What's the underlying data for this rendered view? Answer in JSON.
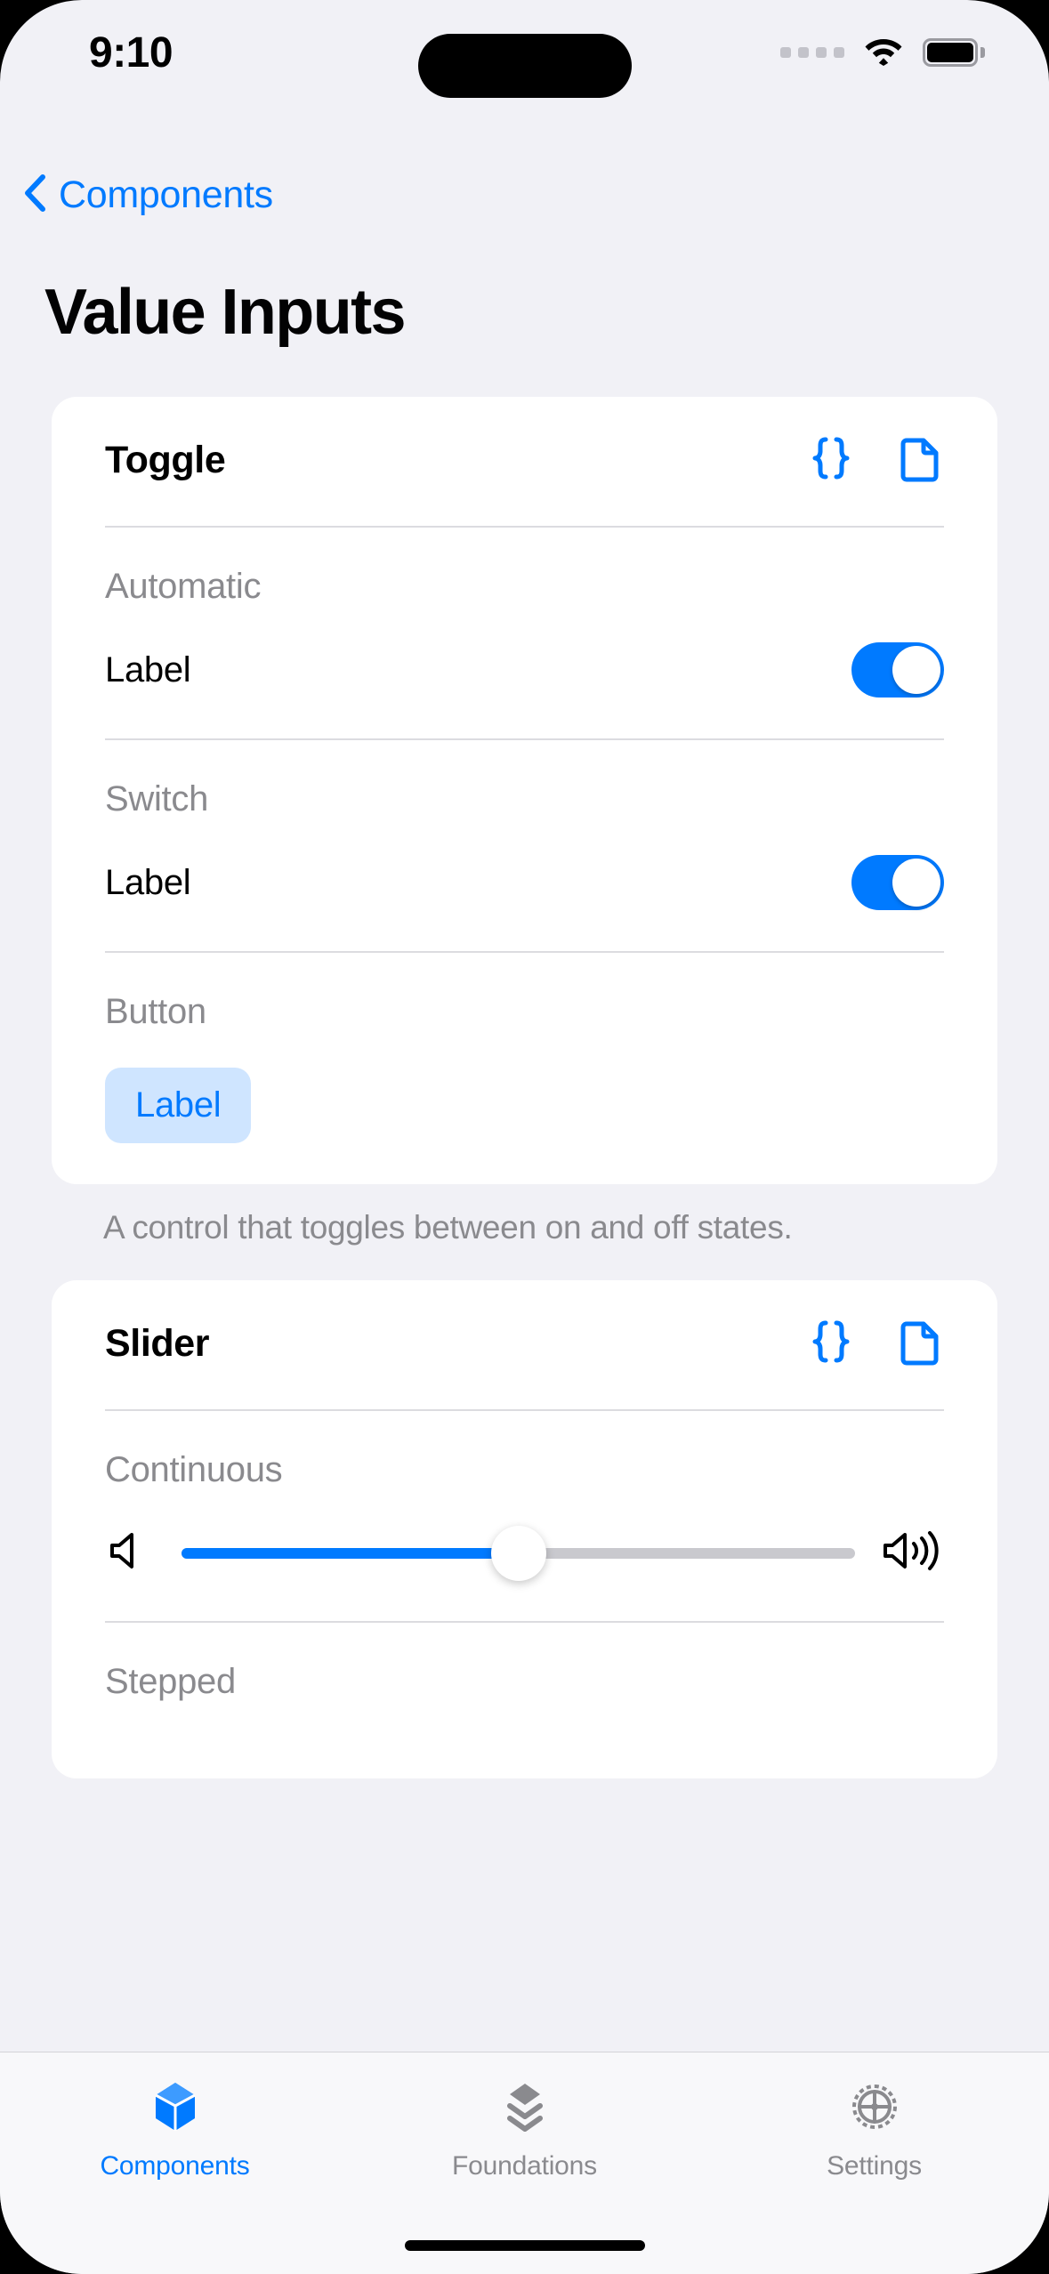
{
  "status_bar": {
    "time": "9:10",
    "signal_icon": "signal-dots-icon",
    "wifi_icon": "wifi-icon",
    "battery_icon": "battery-full-icon"
  },
  "nav": {
    "back_label": "Components",
    "back_icon": "chevron-left-icon",
    "accent": "#007aff"
  },
  "page_title": "Value Inputs",
  "cards": [
    {
      "title": "Toggle",
      "actions": [
        {
          "icon": "code-braces-icon",
          "name": "json-code-button"
        },
        {
          "icon": "document-icon",
          "name": "documentation-button"
        }
      ],
      "caption": "A control that toggles between on and off states.",
      "sections": [
        {
          "label": "Automatic",
          "control": "switch",
          "row_label": "Label",
          "on": true
        },
        {
          "label": "Switch",
          "control": "switch",
          "row_label": "Label",
          "on": true
        },
        {
          "label": "Button",
          "control": "button",
          "button_label": "Label"
        }
      ]
    },
    {
      "title": "Slider",
      "actions": [
        {
          "icon": "code-braces-icon",
          "name": "json-code-button"
        },
        {
          "icon": "document-icon",
          "name": "documentation-button"
        }
      ],
      "sections": [
        {
          "label": "Continuous",
          "control": "slider",
          "value_percent": 50,
          "left_icon": "speaker-min-icon",
          "right_icon": "speaker-max-icon"
        },
        {
          "label": "Stepped",
          "control": "slider"
        }
      ]
    }
  ],
  "tab_bar": {
    "tabs": [
      {
        "label": "Components",
        "icon": "cube-icon",
        "active": true
      },
      {
        "label": "Foundations",
        "icon": "layers-icon",
        "active": false
      },
      {
        "label": "Settings",
        "icon": "gear-icon",
        "active": false
      }
    ]
  },
  "colors": {
    "accent": "#007aff",
    "background": "#f1f1f6",
    "card": "#ffffff",
    "secondary_text": "#8a8a8e",
    "button_fill": "#cfe5ff"
  }
}
